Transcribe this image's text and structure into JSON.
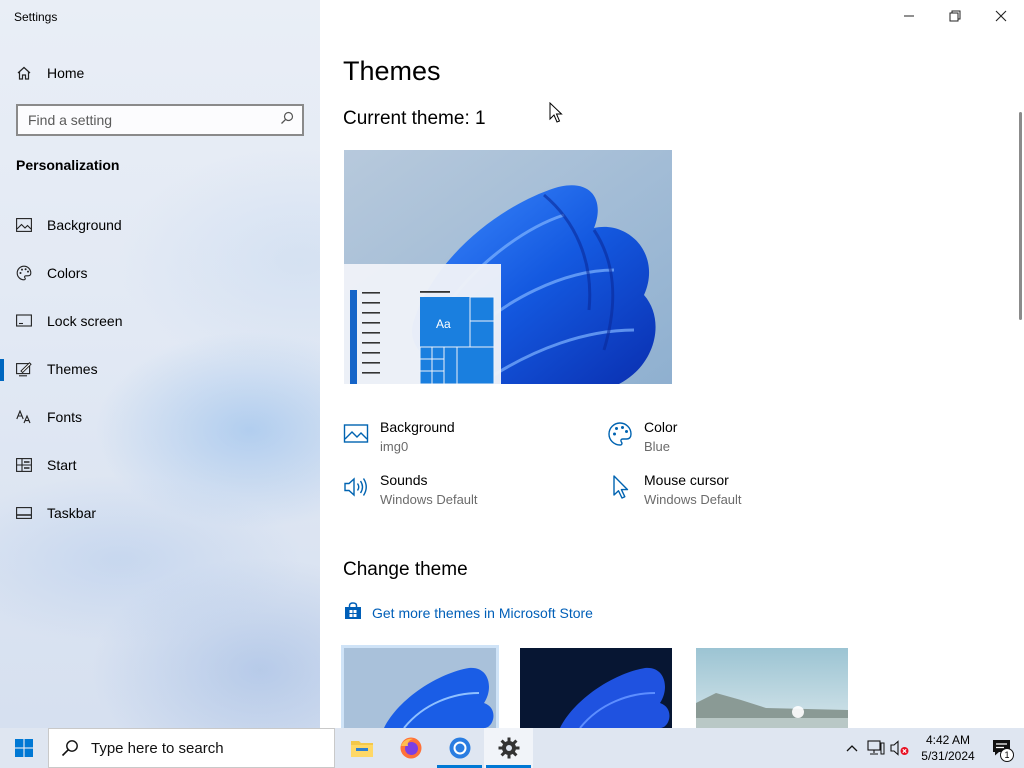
{
  "app": {
    "title": "Settings"
  },
  "sidebar": {
    "home": {
      "label": "Home",
      "icon": "home-icon"
    },
    "search": {
      "placeholder": "Find a setting",
      "icon": "search-icon"
    },
    "section_title": "Personalization",
    "items": [
      {
        "label": "Background",
        "icon": "picture-icon",
        "active": false
      },
      {
        "label": "Colors",
        "icon": "palette-icon",
        "active": false
      },
      {
        "label": "Lock screen",
        "icon": "lock-screen-icon",
        "active": false
      },
      {
        "label": "Themes",
        "icon": "themes-icon",
        "active": true
      },
      {
        "label": "Fonts",
        "icon": "fonts-icon",
        "active": false
      },
      {
        "label": "Start",
        "icon": "start-icon",
        "active": false
      },
      {
        "label": "Taskbar",
        "icon": "taskbar-icon",
        "active": false
      }
    ]
  },
  "main": {
    "title": "Themes",
    "current_theme": "Current theme: 1",
    "preview": {
      "tile_label": "Aa"
    },
    "properties": {
      "background": {
        "label": "Background",
        "value": "img0"
      },
      "color": {
        "label": "Color",
        "value": "Blue"
      },
      "sounds": {
        "label": "Sounds",
        "value": "Windows Default"
      },
      "mouse_cursor": {
        "label": "Mouse cursor",
        "value": "Windows Default"
      }
    },
    "change_theme": "Change theme",
    "store_link": "Get more themes in Microsoft Store",
    "themes": [
      "windows-light",
      "windows-dark",
      "beach"
    ]
  },
  "taskbar": {
    "search_placeholder": "Type here to search",
    "apps": [
      "file-explorer",
      "firefox",
      "chrome",
      "settings"
    ],
    "time": "4:42 AM",
    "date": "5/31/2024",
    "notification_count": "1"
  },
  "colors": {
    "accent": "#0078d4",
    "link": "#005fb8",
    "sidebar_bg": "#e2e9f4",
    "taskbar_bg": "#dfe6f1"
  }
}
